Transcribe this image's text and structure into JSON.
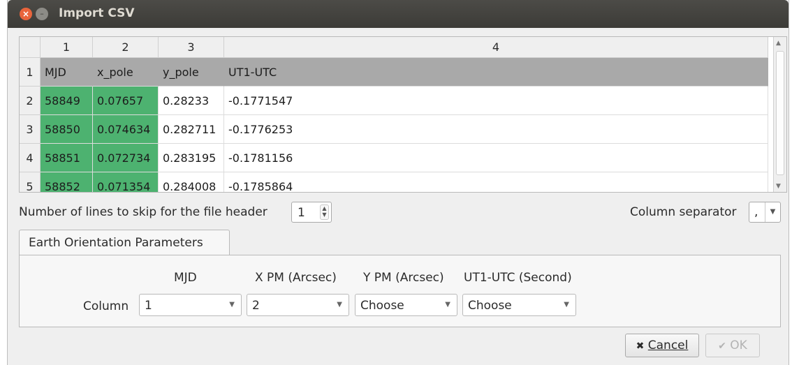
{
  "window": {
    "title": "Import CSV"
  },
  "table": {
    "column_numbers": [
      "1",
      "2",
      "3",
      "4"
    ],
    "row_numbers": [
      "1",
      "2",
      "3",
      "4",
      "5"
    ],
    "header": [
      "MJD",
      "x_pole",
      "y_pole",
      "UT1-UTC"
    ],
    "rows": [
      [
        "58849",
        "0.07657",
        "0.28233",
        "-0.1771547"
      ],
      [
        "58850",
        "0.074634",
        "0.282711",
        "-0.1776253"
      ],
      [
        "58851",
        "0.072734",
        "0.283195",
        "-0.1781156"
      ],
      [
        "58852",
        "0.071354",
        "0.284008",
        "-0.1785864"
      ]
    ],
    "highlight_color": "#4db270",
    "header_row_color": "#a9a9a9"
  },
  "skip": {
    "label": "Number of lines to skip for the file header",
    "value": "1"
  },
  "separator": {
    "label": "Column separator",
    "value": ","
  },
  "tab": {
    "label": "Earth Orientation Parameters"
  },
  "eop": {
    "headers": [
      "MJD",
      "X PM (Arcsec)",
      "Y PM (Arcsec)",
      "UT1-UTC (Second)"
    ],
    "column_label": "Column",
    "selections": [
      "1",
      "2",
      "Choose",
      "Choose"
    ]
  },
  "buttons": {
    "cancel": "Cancel",
    "ok": "OK"
  },
  "icons": {
    "close": "close-icon",
    "minimize": "minimize-icon",
    "cancel": "x-icon",
    "ok": "check-icon"
  }
}
